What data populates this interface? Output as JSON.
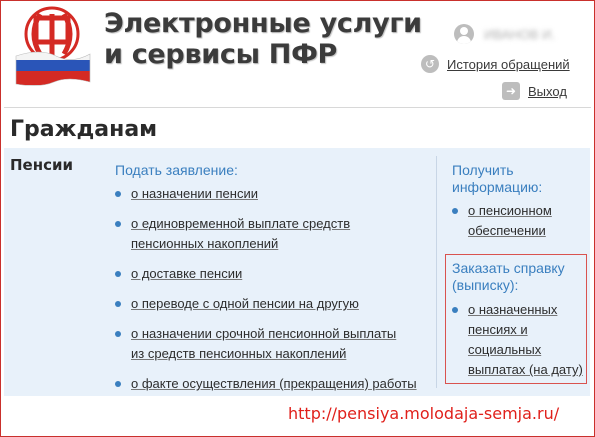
{
  "header": {
    "site_title_line1": "Электронные услуги",
    "site_title_line2": "и сервисы ПФР",
    "logo_text": "ПФР",
    "user_name": "ИВАНОВ И.",
    "history_link": "История обращений",
    "logout_link": "Выход"
  },
  "section": {
    "title": "Гражданам",
    "category": "Пенсии"
  },
  "apply": {
    "heading": "Подать заявление:",
    "items": [
      [
        "о назначении пенсии"
      ],
      [
        "о единовременной выплате средств",
        "пенсионных накоплений"
      ],
      [
        "о доставке пенсии"
      ],
      [
        "о переводе с одной пенсии на другую"
      ],
      [
        "о назначении срочной пенсионной выплаты",
        "из средств пенсионных накоплений"
      ],
      [
        "о факте осуществления (прекращения) работы"
      ]
    ]
  },
  "info": {
    "heading_line1": "Получить",
    "heading_line2": "информацию:",
    "items": [
      [
        "о пенсионном",
        "обеспечении"
      ]
    ]
  },
  "certificate": {
    "heading_line1": "Заказать справку",
    "heading_line2": "(выписку):",
    "items": [
      [
        "о назначенных",
        "пенсиях и",
        "социальных",
        "выплатах (на дату)"
      ]
    ]
  },
  "watermark": "http://pensiya.molodaja-semja.ru/",
  "colors": {
    "accent_blue": "#3a7fbf",
    "panel_bg": "#e8f1fa",
    "highlight_red": "#d9534f",
    "watermark_red": "#e0201b"
  }
}
